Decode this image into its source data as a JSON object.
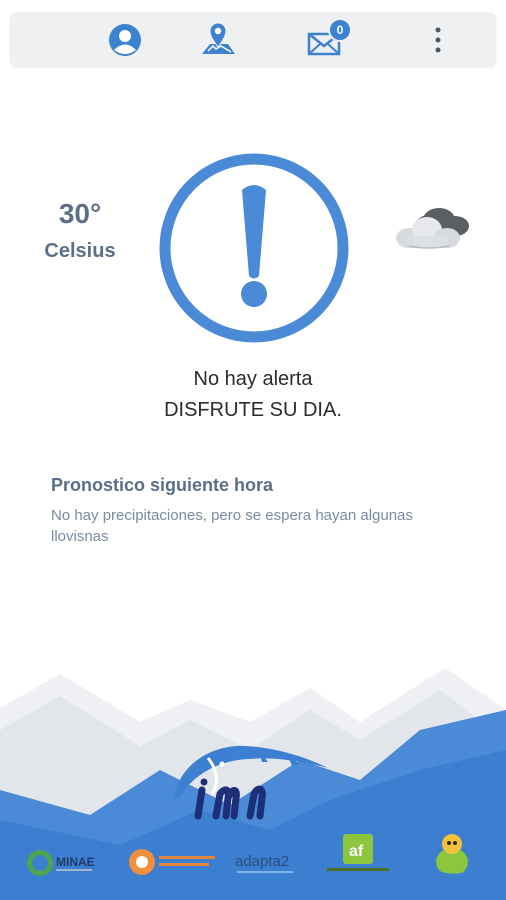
{
  "toolbar": {
    "badge_count": "0",
    "icons": [
      "user-icon",
      "map-pin-icon",
      "mail-icon",
      "more-vert-icon"
    ]
  },
  "weather": {
    "temperature": "30°",
    "unit": "Celsius",
    "condition_icon": "cloudy-icon"
  },
  "alert": {
    "line1": "No hay alerta",
    "line2": "DISFRUTE SU DIA."
  },
  "forecast": {
    "title": "Pronostico siguiente hora",
    "description": "No hay precipitaciones, pero se espera hayan algunas llovisnas"
  },
  "footer": {
    "brand": "imn",
    "partner_logos": [
      "MINAE",
      "Comisión Nacional de Emergencias",
      "adapta2",
      "Fondo Adaptación",
      "Bandera Azul"
    ]
  },
  "colors": {
    "accent": "#4a8ad6",
    "text_muted": "#5b6f88",
    "toolbar_bg": "#eef0f2"
  }
}
